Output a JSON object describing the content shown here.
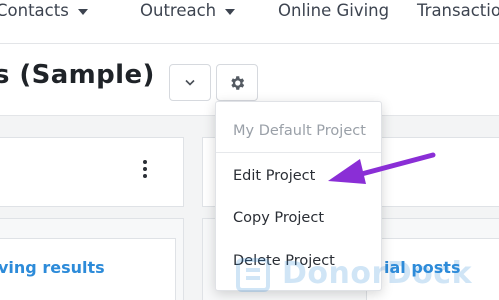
{
  "nav": {
    "contacts": "Contacts",
    "outreach": "Outreach",
    "online_giving": "Online Giving",
    "transactions": "Transactio"
  },
  "header": {
    "title": "s (Sample)",
    "collapse_icon": "chevron-down-icon",
    "settings_icon": "gear-icon"
  },
  "panels": {
    "left_link": "ving results",
    "right_link": "ial posts"
  },
  "menu": {
    "header": "My Default Project",
    "items": [
      "Edit Project",
      "Copy Project",
      "Delete Project"
    ]
  },
  "annotation": {
    "arrow_color": "#8a2ed6"
  },
  "watermark": {
    "text": "DonorDock"
  },
  "colors": {
    "link": "#2d8bd9",
    "text": "#3d4450"
  }
}
